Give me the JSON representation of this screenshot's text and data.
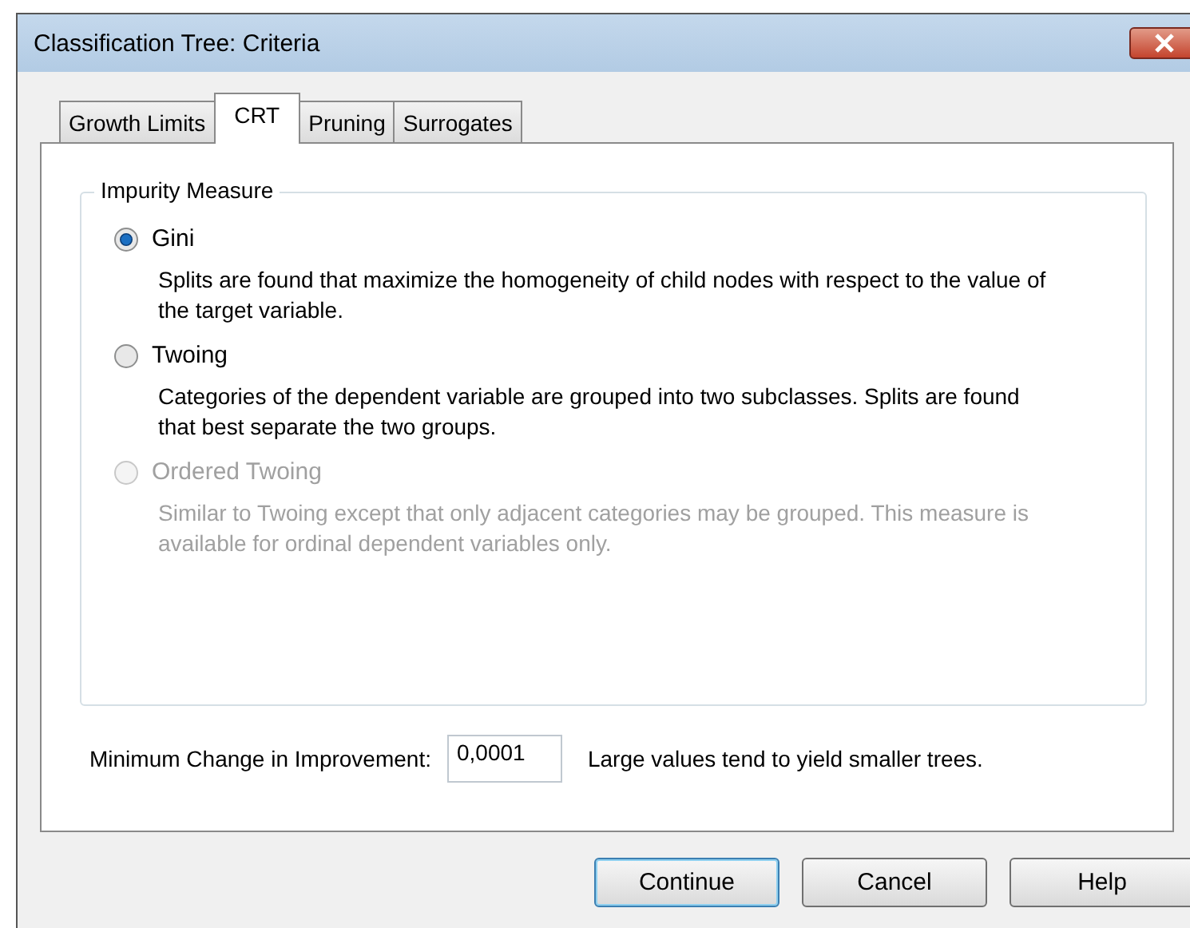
{
  "window": {
    "title": "Classification Tree: Criteria"
  },
  "tabs": [
    {
      "label": "Growth Limits",
      "selected": false
    },
    {
      "label": "CRT",
      "selected": true
    },
    {
      "label": "Pruning",
      "selected": false
    },
    {
      "label": "Surrogates",
      "selected": false
    }
  ],
  "group": {
    "title": "Impurity Measure",
    "options": [
      {
        "label": "Gini",
        "selected": true,
        "disabled": false,
        "description": "Splits are found that maximize the homogeneity of child nodes with respect to the value of the target variable."
      },
      {
        "label": "Twoing",
        "selected": false,
        "disabled": false,
        "description": "Categories of the dependent variable are grouped into two subclasses. Splits are found that best separate the two groups."
      },
      {
        "label": "Ordered Twoing",
        "selected": false,
        "disabled": true,
        "description": "Similar to Twoing except that only adjacent categories may be grouped. This measure is available for ordinal dependent variables only."
      }
    ]
  },
  "min_change": {
    "label": "Minimum Change in Improvement:",
    "value": "0,0001",
    "hint": "Large values tend to yield smaller trees."
  },
  "buttons": [
    {
      "label": "Continue",
      "default": true
    },
    {
      "label": "Cancel",
      "default": false
    },
    {
      "label": "Help",
      "default": false
    }
  ]
}
